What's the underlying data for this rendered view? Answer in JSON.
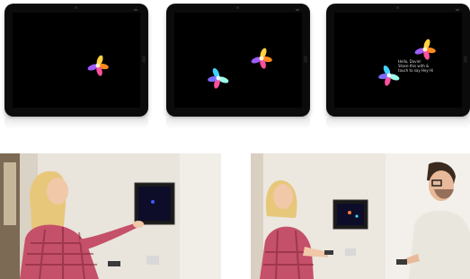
{
  "frames": [
    {
      "flowers": [
        "orange"
      ]
    },
    {
      "flowers": [
        "orange",
        "blue"
      ]
    },
    {
      "flowers": [
        "orange",
        "blue"
      ],
      "caption_lines": [
        "Hello, Davie!",
        "Share this with &",
        "touch to say Hey Hi"
      ]
    }
  ],
  "colors": {
    "bezel": "#0b0b0b",
    "screen": "#000000",
    "orange_flower": [
      "#ff8a1c",
      "#ff4fa0",
      "#a05cff",
      "#ffd23f"
    ],
    "blue_flower": [
      "#3fd4ff",
      "#ff4fa0",
      "#7b6cff",
      "#9bffea"
    ]
  },
  "photos": [
    {
      "scene": "woman pointing at wall-mounted tablet"
    },
    {
      "scene": "woman and man holding phones near wall tablet"
    }
  ]
}
